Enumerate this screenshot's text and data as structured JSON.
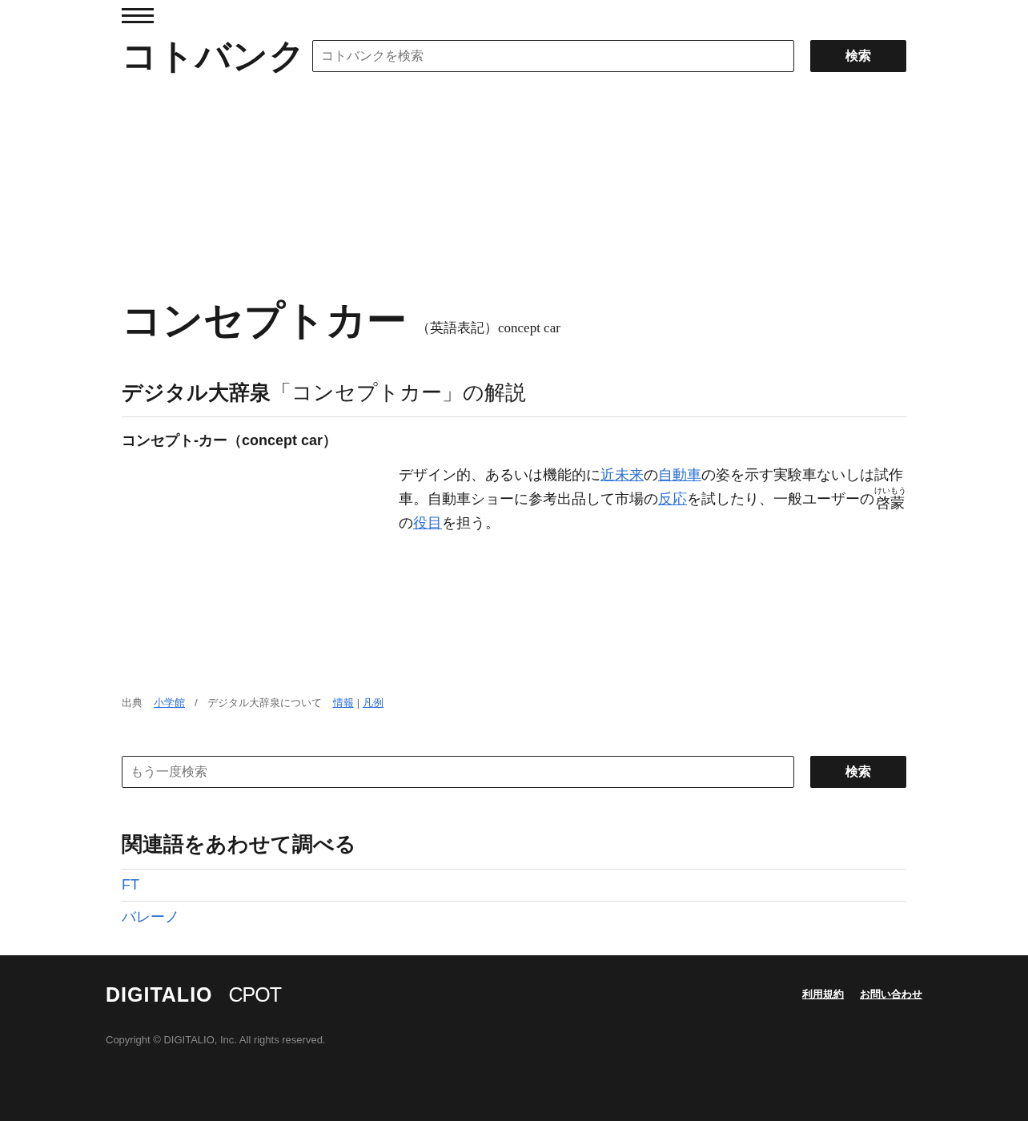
{
  "header": {
    "logo": "コトバンク",
    "search": {
      "placeholder": "コトバンクを検索"
    },
    "search_button": "検索"
  },
  "entry": {
    "title": "コンセプトカー",
    "english": "（英語表記）concept car"
  },
  "dictionary": {
    "name": "デジタル大辞泉",
    "caption": "「コンセプトカー」の解説",
    "headword": "コンセプト-カー（concept car）",
    "body": [
      {
        "kind": "text",
        "text": "デザイン的、あるいは機能的に"
      },
      {
        "kind": "link",
        "text": "近未来"
      },
      {
        "kind": "text",
        "text": "の"
      },
      {
        "kind": "link",
        "text": "自動車"
      },
      {
        "kind": "text",
        "text": "の姿を示す実験車ないしは試作車。自動車ショーに参考出品して市場の"
      },
      {
        "kind": "link",
        "text": "反応"
      },
      {
        "kind": "text",
        "text": "を試したり、一般ユーザーの"
      },
      {
        "kind": "ruby",
        "text": "啓蒙",
        "ruby": "けいもう"
      },
      {
        "kind": "text",
        "text": "の"
      },
      {
        "kind": "link",
        "text": "役目"
      },
      {
        "kind": "text",
        "text": "を担う。"
      }
    ],
    "source": {
      "label": "出典",
      "publisher": "小学館",
      "separator": "/",
      "about": "デジタル大辞泉について",
      "info": "情報",
      "pipe": "|",
      "legend": "凡例"
    }
  },
  "search_again": {
    "placeholder": "もう一度検索",
    "button": "検索"
  },
  "related": {
    "heading": "関連語をあわせて調べる",
    "items": [
      "FT",
      "バレーノ"
    ]
  },
  "footer": {
    "logos": [
      "DIGITALIO",
      "CPOT"
    ],
    "links": [
      "利用規約",
      "お問い合わせ"
    ],
    "copyright": "Copyright © DIGITALIO, Inc. All rights reserved."
  }
}
